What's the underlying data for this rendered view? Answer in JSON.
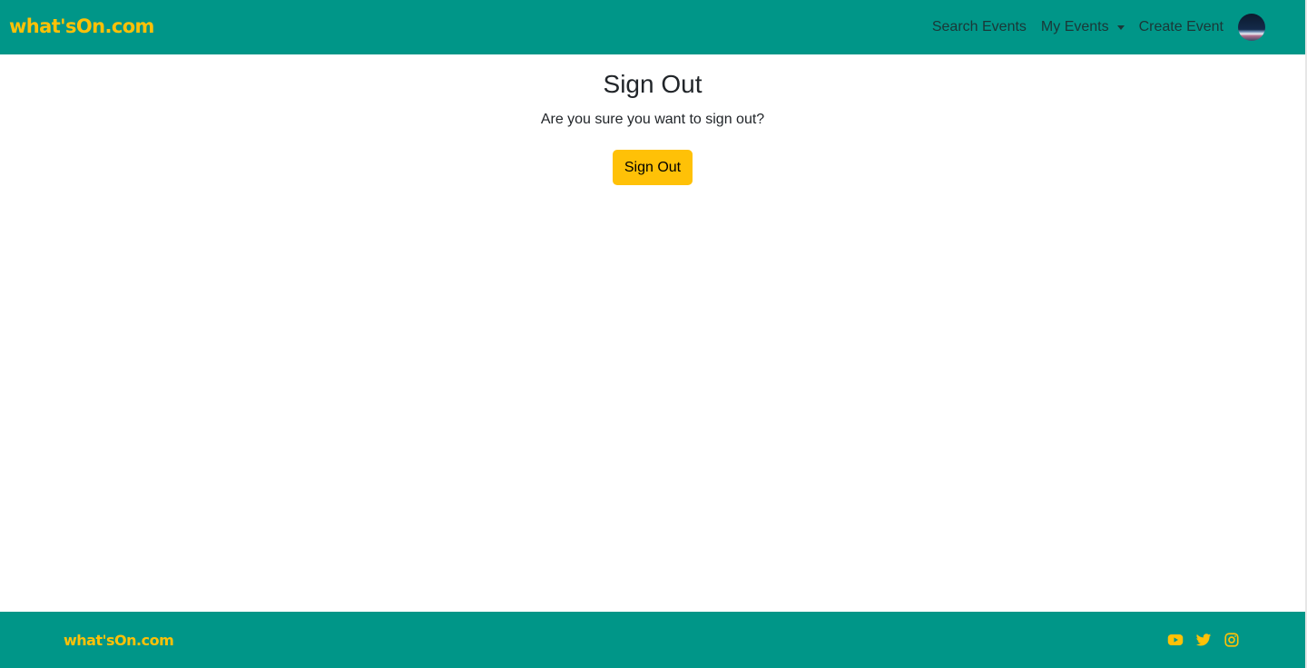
{
  "header": {
    "brand": "what'sOn.com",
    "nav": {
      "search_events": "Search Events",
      "my_events": "My Events",
      "create_event": "Create Event"
    },
    "avatar_icon": "user-avatar"
  },
  "main": {
    "title": "Sign Out",
    "message": "Are you sure you want to sign out?",
    "button_label": "Sign Out"
  },
  "footer": {
    "brand": "what'sOn.com",
    "social_icons": [
      "youtube-icon",
      "twitter-icon",
      "instagram-icon"
    ]
  },
  "colors": {
    "primary": "#009688",
    "accent": "#ffc107",
    "text": "#212529"
  }
}
